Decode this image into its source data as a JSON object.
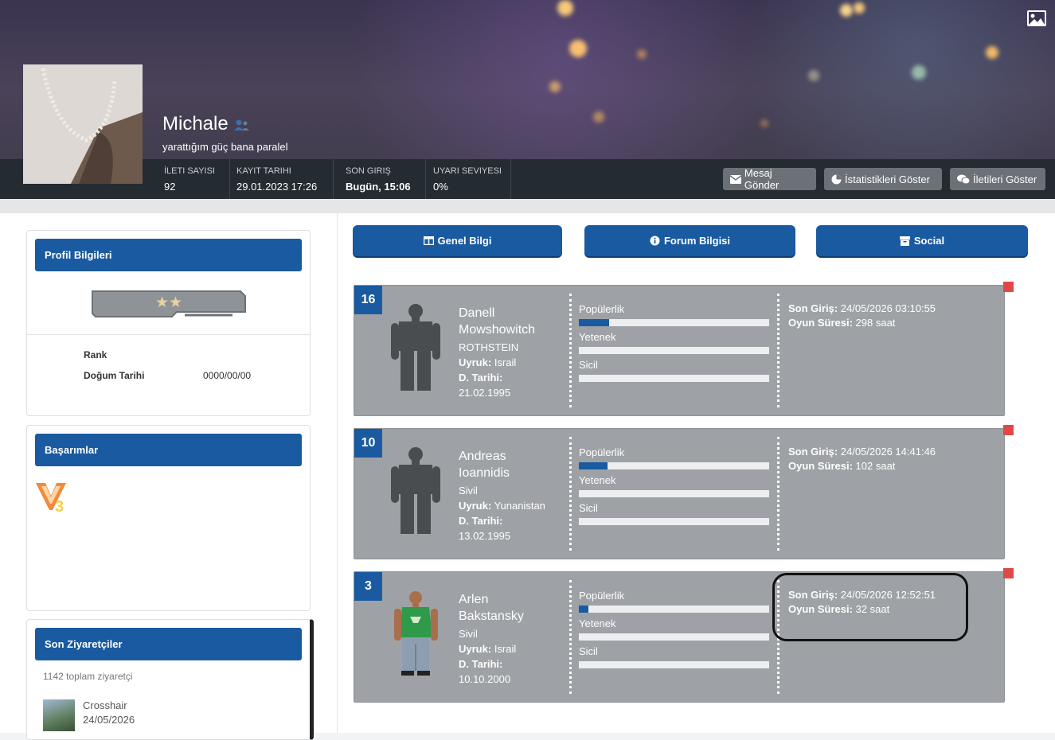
{
  "profile": {
    "username": "Michale",
    "status": "yarattığım güç bana paralel",
    "stats": [
      {
        "label": "İLETI SAYISI",
        "value": "92"
      },
      {
        "label": "KAYIT TARIHI",
        "value": "29.01.2023 17:26"
      },
      {
        "label": "SON GIRIŞ",
        "value": "Bugün, 15:06"
      },
      {
        "label": "UYARI SEVIYESI",
        "value": "0%"
      }
    ],
    "buttons": {
      "message": "Mesaj Gönder",
      "stats": "İstatistikleri Göster",
      "posts": "İletileri Göster"
    }
  },
  "sidebar": {
    "profile_box": {
      "title": "Profil Bilgileri",
      "rank_label": "Rank",
      "birth_label": "Doğum Tarihi",
      "birth_value": "0000/00/00",
      "stars": "★★"
    },
    "achievements": {
      "title": "Başarımlar"
    },
    "visitors": {
      "title": "Son Ziyaretçiler",
      "total": "1142 toplam ziyaretçi",
      "items": [
        {
          "name": "Crosshair",
          "date": "24/05/2026"
        }
      ]
    }
  },
  "tabs": [
    {
      "label": "Genel Bilgi",
      "icon": "columns-icon"
    },
    {
      "label": "Forum Bilgisi",
      "icon": "info-circle-icon"
    },
    {
      "label": "Social",
      "icon": "archive-icon"
    }
  ],
  "characters": [
    {
      "level": "16",
      "first_name": "Danell",
      "last_name": "Mowshowitch",
      "faction": "ROTHSTEIN",
      "nationality_label": "Uyruk:",
      "nationality": "Israil",
      "birth_label": "D. Tarihi:",
      "birth": "21.02.1995",
      "bar_labels": [
        "Popülerlik",
        "Yetenek",
        "Sicil"
      ],
      "bar_values": [
        0.16,
        0,
        0
      ],
      "last_login_label": "Son Giriş:",
      "last_login": "24/05/2026 03:10:55",
      "playtime_label": "Oyun Süresi:",
      "playtime": "298 saat",
      "skin": "default"
    },
    {
      "level": "10",
      "first_name": "Andreas",
      "last_name": "Ioannidis",
      "faction": "Sivil",
      "nationality_label": "Uyruk:",
      "nationality": "Yunanistan",
      "birth_label": "D. Tarihi:",
      "birth": "13.02.1995",
      "bar_labels": [
        "Popülerlik",
        "Yetenek",
        "Sicil"
      ],
      "bar_values": [
        0.15,
        0,
        0
      ],
      "last_login_label": "Son Giriş:",
      "last_login": "24/05/2026 14:41:46",
      "playtime_label": "Oyun Süresi:",
      "playtime": "102 saat",
      "skin": "default"
    },
    {
      "level": "3",
      "first_name": "Arlen",
      "last_name": "Bakstansky",
      "faction": "Sivil",
      "nationality_label": "Uyruk:",
      "nationality": "Israil",
      "birth_label": "D. Tarihi:",
      "birth": "10.10.2000",
      "bar_labels": [
        "Popülerlik",
        "Yetenek",
        "Sicil"
      ],
      "bar_values": [
        0.05,
        0,
        0
      ],
      "last_login_label": "Son Giriş:",
      "last_login": "24/05/2026 12:52:51",
      "playtime_label": "Oyun Süresi:",
      "playtime": "32 saat",
      "skin": "green-shirt"
    }
  ],
  "colors": {
    "accent": "#1a5aa0",
    "card_bg": "#9ea2a6",
    "flag": "#e04848"
  }
}
